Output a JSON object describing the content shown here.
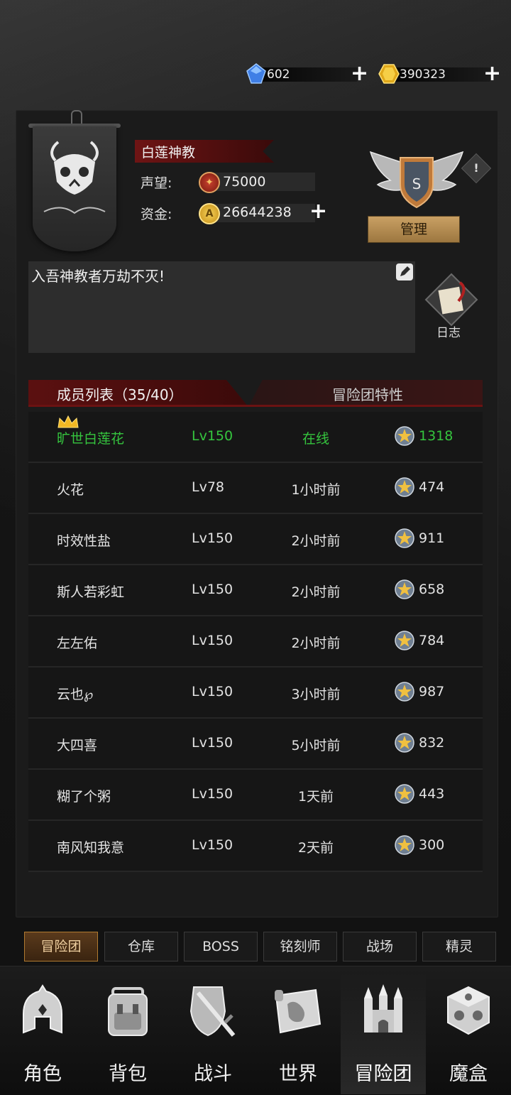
{
  "currency": {
    "diamond_value": "602",
    "gold_value": "390323",
    "diamond_icon": "diamond-icon",
    "gold_icon": "gold-gem-icon"
  },
  "guild": {
    "name": "白莲神教",
    "reputation_label": "声望:",
    "reputation_value": "75000",
    "funds_label": "资金:",
    "funds_value": "26644238",
    "rank_letter": "S",
    "info_badge": "!",
    "manage_label": "管理",
    "motto": "入吾神教者万劫不灭!",
    "log_label": "日志"
  },
  "tabs": {
    "members_label": "成员列表（35/40）",
    "traits_label": "冒险团特性"
  },
  "members": [
    {
      "name": "旷世白莲花",
      "level": "Lv150",
      "status": "在线",
      "points": "1318",
      "online": true
    },
    {
      "name": "火花",
      "level": "Lv78",
      "status": "1小时前",
      "points": "474"
    },
    {
      "name": "时效性盐",
      "level": "Lv150",
      "status": "2小时前",
      "points": "911"
    },
    {
      "name": "斯人若彩虹",
      "level": "Lv150",
      "status": "2小时前",
      "points": "658"
    },
    {
      "name": "左左佑",
      "level": "Lv150",
      "status": "2小时前",
      "points": "784"
    },
    {
      "name": "云也℘",
      "level": "Lv150",
      "status": "3小时前",
      "points": "987"
    },
    {
      "name": "大四喜",
      "level": "Lv150",
      "status": "5小时前",
      "points": "832"
    },
    {
      "name": "糊了个粥",
      "level": "Lv150",
      "status": "1天前",
      "points": "443"
    },
    {
      "name": "南风知我意",
      "level": "Lv150",
      "status": "2天前",
      "points": "300"
    }
  ],
  "submenu": [
    "冒险团",
    "仓库",
    "BOSS",
    "铭刻师",
    "战场",
    "精灵"
  ],
  "nav": [
    "角色",
    "背包",
    "战斗",
    "世界",
    "冒险团",
    "魔盒"
  ],
  "colors": {
    "online_green": "#35c53e",
    "tab_red": "#6b1212",
    "manage_gold": "#c9a064"
  }
}
